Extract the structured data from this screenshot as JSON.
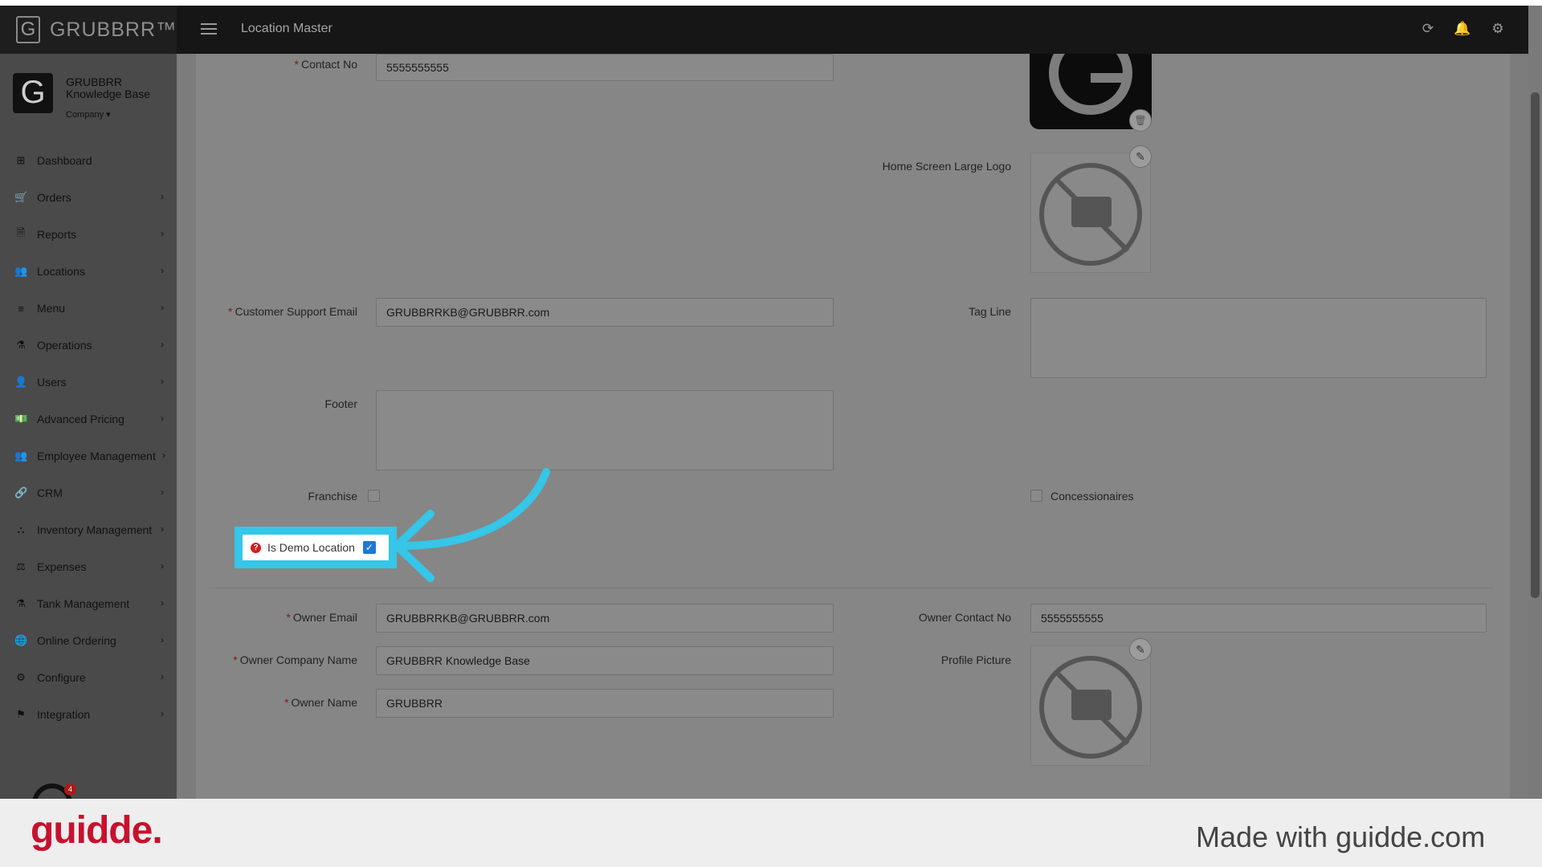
{
  "app": {
    "brand": "GRUBBRR™",
    "brand_letter": "G",
    "page_title": "Location Master"
  },
  "header_icons": {
    "refresh": "refresh-icon",
    "notifications": "bell-icon",
    "settings": "gear-icon"
  },
  "company": {
    "name": "GRUBBRR Knowledge Base",
    "switch_label": "Company ▾",
    "logo_letter": "G",
    "notification_count": "4"
  },
  "sidebar": {
    "items": [
      {
        "label": "Dashboard",
        "icon": "⊞",
        "chevron": ""
      },
      {
        "label": "Orders",
        "icon": "🛒",
        "chevron": "›"
      },
      {
        "label": "Reports",
        "icon": "🗎",
        "chevron": "›"
      },
      {
        "label": "Locations",
        "icon": "👥",
        "chevron": "›"
      },
      {
        "label": "Menu",
        "icon": "≡",
        "chevron": "›"
      },
      {
        "label": "Operations",
        "icon": "⚗",
        "chevron": "›"
      },
      {
        "label": "Users",
        "icon": "👤",
        "chevron": "›"
      },
      {
        "label": "Advanced Pricing",
        "icon": "💵",
        "chevron": "›"
      },
      {
        "label": "Employee Management",
        "icon": "👥",
        "chevron": "›"
      },
      {
        "label": "CRM",
        "icon": "🔗",
        "chevron": "›"
      },
      {
        "label": "Inventory Management",
        "icon": "⛬",
        "chevron": "›"
      },
      {
        "label": "Expenses",
        "icon": "⚖",
        "chevron": "›"
      },
      {
        "label": "Tank Management",
        "icon": "⚗",
        "chevron": "›"
      },
      {
        "label": "Online Ordering",
        "icon": "🌐",
        "chevron": "›"
      },
      {
        "label": "Configure",
        "icon": "⚙",
        "chevron": "›"
      },
      {
        "label": "Integration",
        "icon": "⚑",
        "chevron": "›"
      }
    ]
  },
  "form": {
    "contact_no": {
      "label": "Contact No",
      "value": "5555555555"
    },
    "home_screen_large_logo": {
      "label": "Home Screen Large Logo"
    },
    "customer_support_email": {
      "label": "Customer Support Email",
      "value": "GRUBBRRKB@GRUBBRR.com"
    },
    "tag_line": {
      "label": "Tag Line",
      "value": ""
    },
    "footer": {
      "label": "Footer",
      "value": ""
    },
    "franchise": {
      "label": "Franchise"
    },
    "concessionaires": {
      "label": "Concessionaires"
    },
    "demo_location": {
      "label": "Is Demo Location",
      "help": "?",
      "check": "✓"
    },
    "owner_email": {
      "label": "Owner Email",
      "value": "GRUBBRRKB@GRUBBRR.com"
    },
    "owner_contact_no": {
      "label": "Owner Contact No",
      "value": "5555555555"
    },
    "owner_company_name": {
      "label": "Owner Company Name",
      "value": "GRUBBRR Knowledge Base"
    },
    "profile_picture": {
      "label": "Profile Picture"
    },
    "owner_name": {
      "label": "Owner Name",
      "value": "GRUBBRR"
    },
    "required_mark": "*"
  },
  "footer_bar": {
    "logo": "guidde.",
    "made_with": "Made with guidde.com"
  },
  "colors": {
    "highlight": "#35c6e8",
    "brand_red": "#c8102e",
    "checkbox_blue": "#1e7ad4"
  }
}
